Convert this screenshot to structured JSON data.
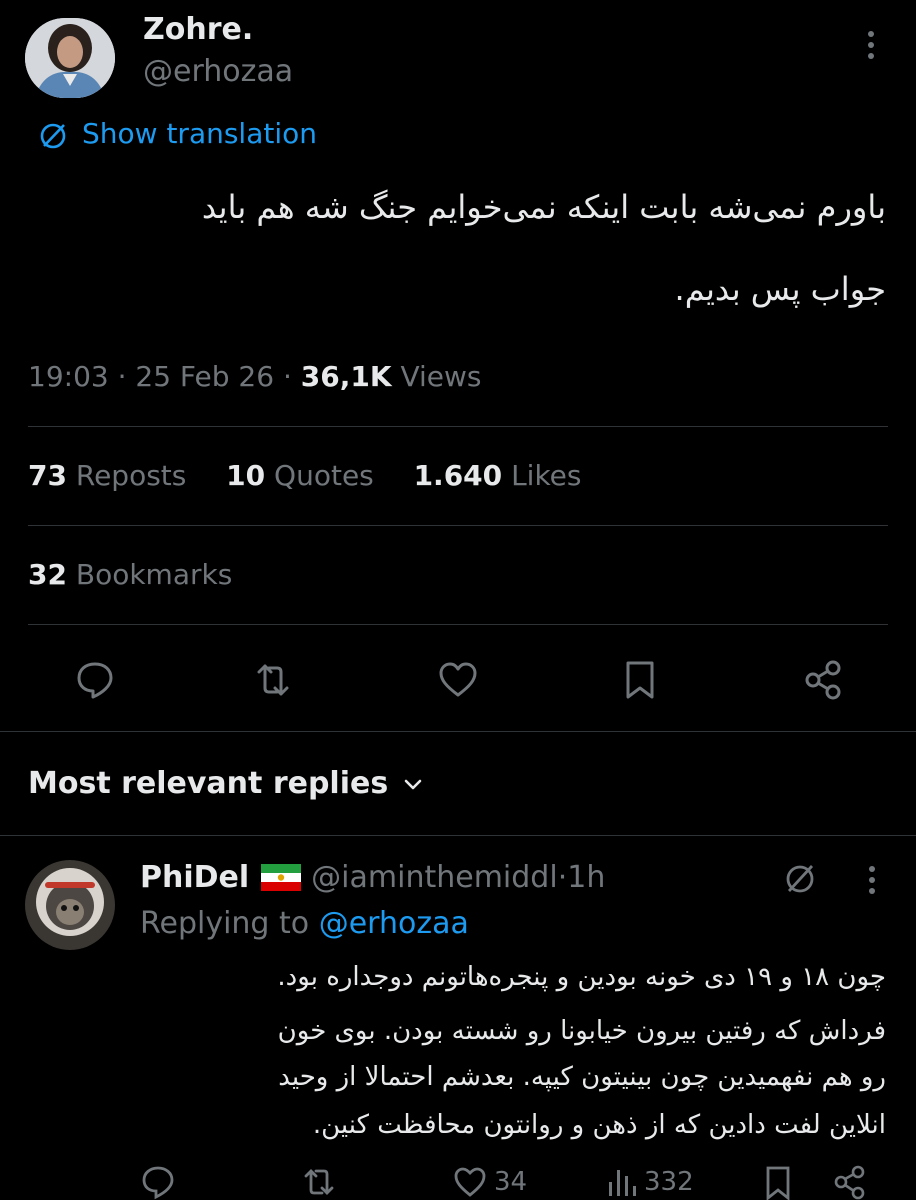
{
  "tweet": {
    "author_name": "Zohre.",
    "author_handle": "@erhozaa",
    "translate_label": "Show translation",
    "text_line1": "باورم نمی‌شه بابت اینکه نمی‌خوایم جنگ شه هم باید",
    "text_line2": "جواب پس بدیم.",
    "time": "19:03",
    "date": "25 Feb 26",
    "views_count": "36,1K",
    "views_label": "Views",
    "reposts_count": "73",
    "reposts_label": "Reposts",
    "quotes_count": "10",
    "quotes_label": "Quotes",
    "likes_count": "1.640",
    "likes_label": "Likes",
    "bookmarks_count": "32",
    "bookmarks_label": "Bookmarks"
  },
  "replies_header": {
    "label": "Most relevant replies"
  },
  "reply": {
    "author_name": "PhiDel",
    "flag_icon": "iran-lion-sun-flag-icon",
    "author_handle": "@iaminthemiddl",
    "time": "1h",
    "replying_to_label": "Replying to",
    "replying_to_handle": "@erhozaa",
    "lines": [
      "چون ۱۸ و ۱۹ دی خونه بودین و پنجره‌هاتونم دوجداره بود.",
      "فرداش که رفتین بیرون خیابونا رو شسته بودن. بوی خون",
      "رو هم نفهمیدین چون بینیتون کیپه. بعدشم احتمالا از وحید",
      "انلاین لفت دادین که از ذهن و روانتون محافظت کنین."
    ],
    "likes": "34",
    "views": "332"
  },
  "colors": {
    "background": "#000000",
    "text": "#e7e9ea",
    "muted": "#71767b",
    "accent": "#1d9bf0",
    "divider": "#2f3336"
  }
}
